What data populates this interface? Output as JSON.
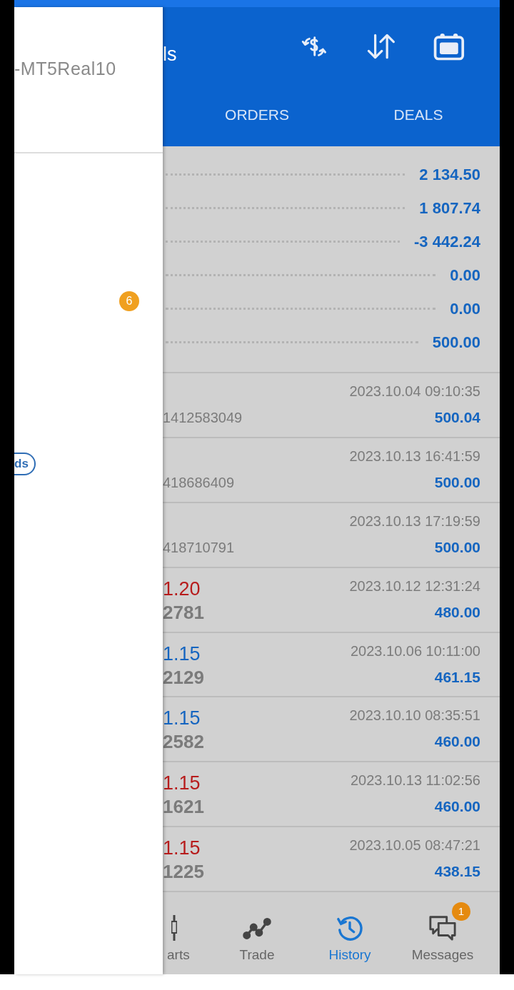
{
  "drawer": {
    "account": "-MT5Real10",
    "badge": "6",
    "pill_button": "ds"
  },
  "header": {
    "title": "ls"
  },
  "tabs": [
    {
      "label": "ORDERS",
      "selected": false
    },
    {
      "label": "DEALS",
      "selected": false
    }
  ],
  "summary": [
    "2 134.50",
    "1 807.74",
    "-3 442.24",
    "0.00",
    "0.00",
    "500.00"
  ],
  "deals": [
    {
      "kind": "transfer",
      "ticket": "1412583049",
      "time": "2023.10.04 09:10:35",
      "amount": "500.04"
    },
    {
      "kind": "transfer",
      "ticket": "418686409",
      "time": "2023.10.13 16:41:59",
      "amount": "500.00"
    },
    {
      "kind": "transfer",
      "ticket": "418710791",
      "time": "2023.10.13 17:19:59",
      "amount": "500.00"
    },
    {
      "kind": "trade",
      "price": "1.20",
      "color": "#b71c1c",
      "ticket": "2781",
      "time": "2023.10.12 12:31:24",
      "amount": "480.00"
    },
    {
      "kind": "trade",
      "price": "1.15",
      "color": "#1565c0",
      "ticket": "2129",
      "time": "2023.10.06 10:11:00",
      "amount": "461.15"
    },
    {
      "kind": "trade",
      "price": "1.15",
      "color": "#1565c0",
      "ticket": "2582",
      "time": "2023.10.10 08:35:51",
      "amount": "460.00"
    },
    {
      "kind": "trade",
      "price": "1.15",
      "color": "#b71c1c",
      "ticket": "1621",
      "time": "2023.10.13 11:02:56",
      "amount": "460.00"
    },
    {
      "kind": "trade",
      "price": "1.15",
      "color": "#b71c1c",
      "ticket": "1225",
      "time": "2023.10.05 08:47:21",
      "amount": "438.15"
    }
  ],
  "bottom_nav": [
    {
      "label": "arts",
      "selected": false
    },
    {
      "label": "Trade",
      "selected": false
    },
    {
      "label": "History",
      "selected": true
    },
    {
      "label": "Messages",
      "selected": false,
      "badge": "1"
    }
  ]
}
